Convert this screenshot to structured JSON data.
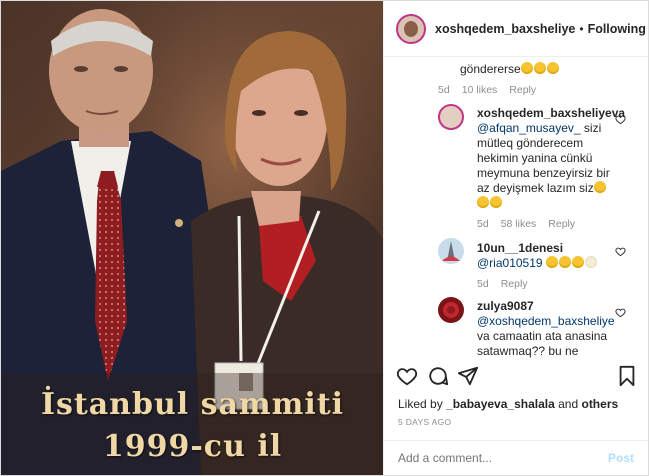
{
  "photo": {
    "caption_line1": "İstanbul sammiti",
    "caption_line2": "1999-cu il"
  },
  "header": {
    "username": "xoshqedem_baxsheliye",
    "separator": "•",
    "follow_status": "Following"
  },
  "comments": [
    {
      "text": "göndererse n",
      "text_display": "göndererse",
      "emoji_count": 3,
      "time": "5d",
      "likes": "10 likes",
      "reply": "Reply"
    },
    {
      "username": "xoshqedem_baxsheliyeva",
      "mention": "@afqan_musayev_",
      "body_line1": " sizi",
      "body_line2": "mütleq gönderecem",
      "body_line3": "hekimin yanina cünkü",
      "body_line4": "meymuna benzeyirsiz bir",
      "body_line5": "az deyişmek lazım siz",
      "time": "5d",
      "likes": "58 likes",
      "reply": "Reply"
    },
    {
      "username": "10un__1denesi",
      "mention": "@ria010519",
      "time": "5d",
      "reply": "Reply"
    },
    {
      "username": "zulya9087",
      "mention": "@xoshqedem_baxsheliye",
      "body_line1": "va camaatin ata anasina",
      "body_line2": "satawmaq?? bu ne"
    }
  ],
  "likes": {
    "prefix": "Liked by ",
    "user": "_babayeva_shalala",
    "middle": " and ",
    "others": "others"
  },
  "time_ago": "5 DAYS AGO",
  "add_comment": {
    "placeholder": "Add a comment...",
    "post_label": "Post"
  },
  "colors": {
    "link": "#00376b",
    "muted": "#8e8e8e",
    "post_disabled": "#b2dffc",
    "story_ring": "#c13584"
  },
  "icons": [
    "heart-icon",
    "comment-icon",
    "share-icon",
    "bookmark-icon"
  ]
}
